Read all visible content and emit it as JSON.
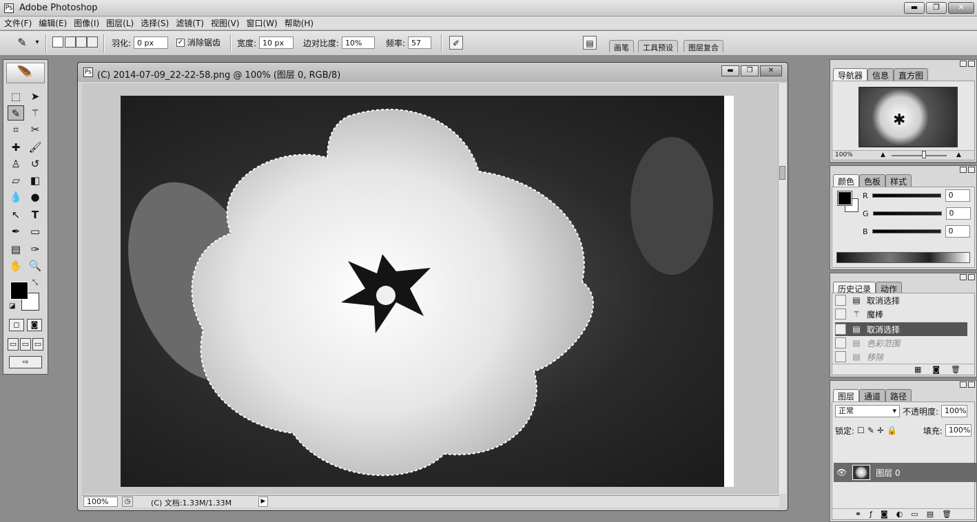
{
  "window": {
    "title": "Adobe Photoshop",
    "controls": {
      "minimize": "▬",
      "restore": "❐",
      "close": "✕"
    }
  },
  "menu": [
    "文件(F)",
    "编辑(E)",
    "图像(I)",
    "图层(L)",
    "选择(S)",
    "滤镜(T)",
    "视图(V)",
    "窗口(W)",
    "帮助(H)"
  ],
  "options": {
    "feather_label": "羽化:",
    "feather_value": "0 px",
    "antialias_label": "消除锯齿",
    "width_label": "宽度:",
    "width_value": "10 px",
    "contrast_label": "边对比度:",
    "contrast_value": "10%",
    "frequency_label": "频率:",
    "frequency_value": "57",
    "wells": [
      "画笔",
      "工具预设",
      "图层复合"
    ]
  },
  "document": {
    "title": "(C) 2014-07-09_22-22-58.png @ 100% (图层 0, RGB/8)",
    "zoom": "100%",
    "doc_info": "(C) 文档:1.33M/1.33M"
  },
  "navigator": {
    "tabs": [
      "导航器",
      "信息",
      "直方图"
    ],
    "zoom": "100%"
  },
  "color": {
    "tabs": [
      "颜色",
      "色板",
      "样式"
    ],
    "channels": [
      {
        "name": "R",
        "value": "0"
      },
      {
        "name": "G",
        "value": "0"
      },
      {
        "name": "B",
        "value": "0"
      }
    ]
  },
  "history": {
    "tabs": [
      "历史记录",
      "动作"
    ],
    "items": [
      {
        "label": "取消选择",
        "state": "normal"
      },
      {
        "label": "魔棒",
        "state": "normal"
      },
      {
        "label": "取消选择",
        "state": "selected"
      },
      {
        "label": "色彩范围",
        "state": "dim"
      },
      {
        "label": "移除",
        "state": "dim"
      }
    ]
  },
  "layers": {
    "tabs": [
      "图层",
      "通道",
      "路径"
    ],
    "blend_mode": "正常",
    "opacity_label": "不透明度:",
    "opacity_value": "100%",
    "lock_label": "锁定:",
    "fill_label": "填充:",
    "fill_value": "100%",
    "items": [
      {
        "name": "图层 0"
      }
    ]
  }
}
